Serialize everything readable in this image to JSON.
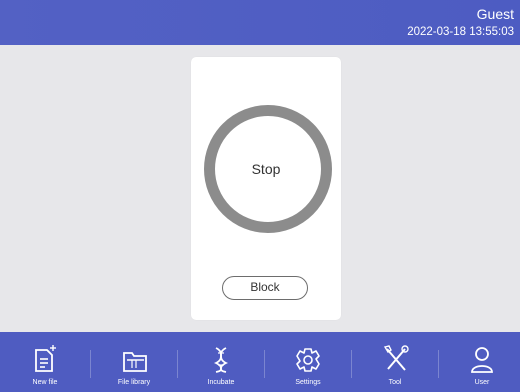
{
  "header": {
    "user": "Guest",
    "datetime": "2022-03-18 13:55:03"
  },
  "main": {
    "status": "Stop",
    "block_button": "Block"
  },
  "nav": [
    {
      "label": "New file",
      "icon": "new-file-icon"
    },
    {
      "label": "File library",
      "icon": "folder-icon"
    },
    {
      "label": "Incubate",
      "icon": "dna-icon"
    },
    {
      "label": "Settings",
      "icon": "gear-icon"
    },
    {
      "label": "Tool",
      "icon": "tools-icon"
    },
    {
      "label": "User",
      "icon": "user-icon"
    }
  ],
  "colors": {
    "header": "#5361c4",
    "bottom_bar": "#4f5cc1",
    "ring": "#8c8c8c"
  }
}
